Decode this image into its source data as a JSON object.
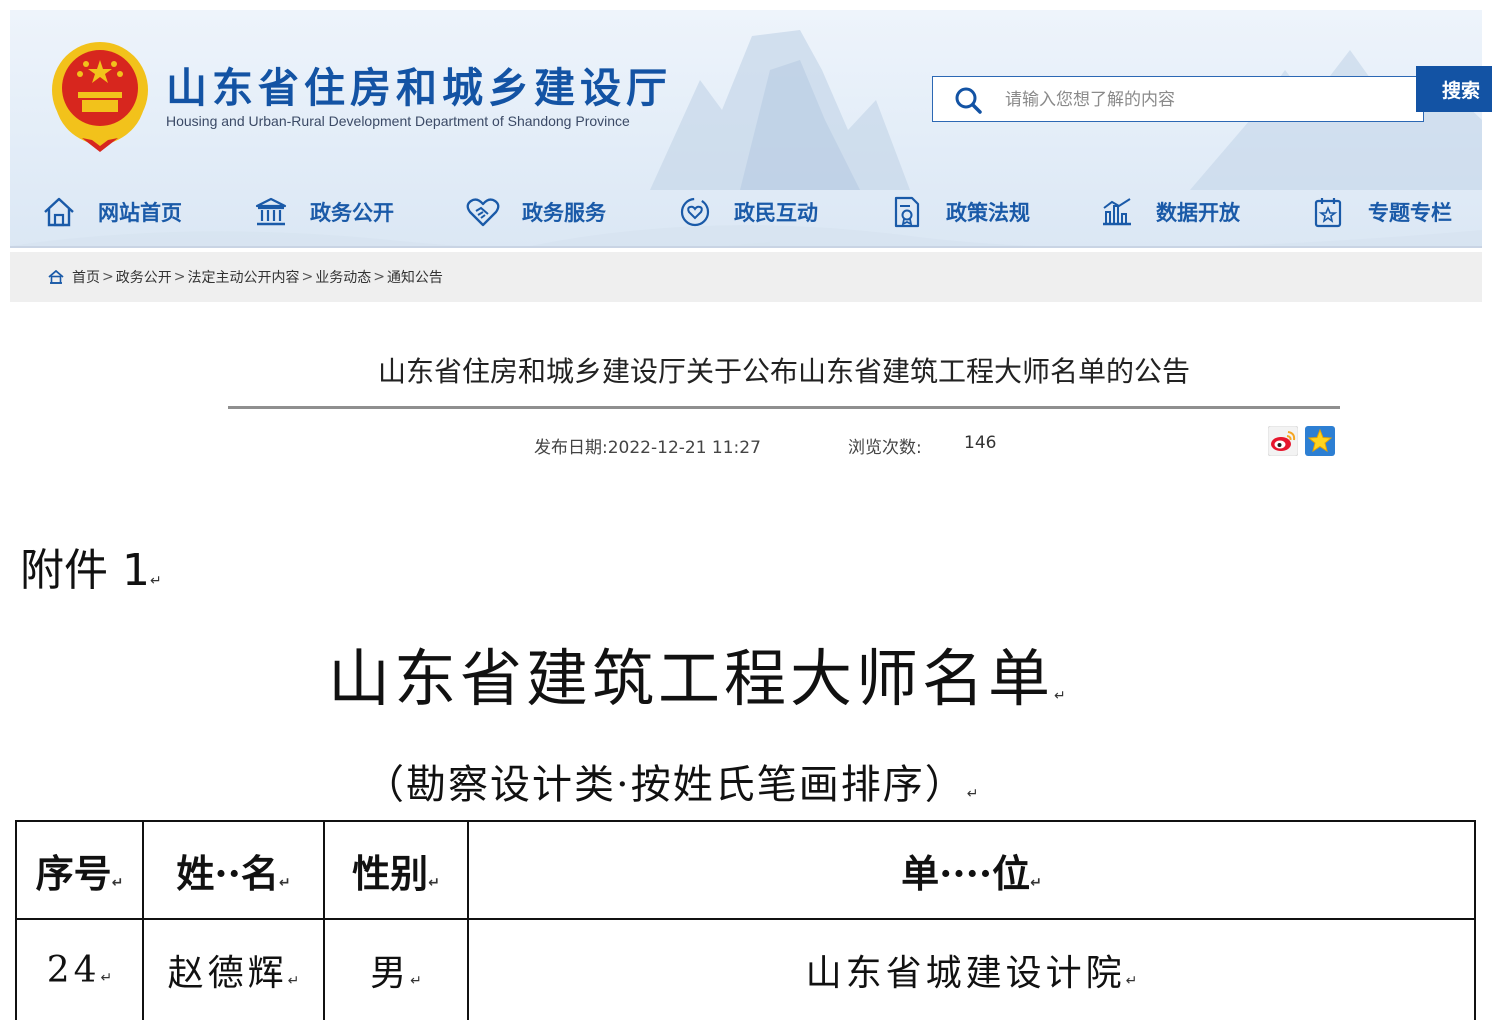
{
  "header": {
    "site_title": "山东省住房和城乡建设厅",
    "site_subtitle": "Housing and Urban-Rural Development Department of Shandong Province",
    "search": {
      "placeholder": "请输入您想了解的内容",
      "button_label": "搜索"
    },
    "nav": [
      {
        "label": "网站首页",
        "icon": "home-icon"
      },
      {
        "label": "政务公开",
        "icon": "government-building-icon"
      },
      {
        "label": "政务服务",
        "icon": "handshake-heart-icon"
      },
      {
        "label": "政民互动",
        "icon": "interaction-heart-icon"
      },
      {
        "label": "政策法规",
        "icon": "document-seal-icon"
      },
      {
        "label": "数据开放",
        "icon": "bar-chart-icon"
      },
      {
        "label": "专题专栏",
        "icon": "special-topic-icon"
      }
    ]
  },
  "breadcrumb": {
    "icon": "home-icon",
    "items": [
      "首页",
      "政务公开",
      "法定主动公开内容",
      "业务动态",
      "通知公告"
    ],
    "separator": ">"
  },
  "article": {
    "title": "山东省住房和城乡建设厅关于公布山东省建筑工程大师名单的公告",
    "date": "发布日期:2022-12-21 11:27",
    "views_label": "浏览次数:",
    "views_value": "146",
    "share_icons": [
      "weibo-icon",
      "favorite-star-icon"
    ]
  },
  "document": {
    "attachment": "附件 1",
    "title": "山东省建筑工程大师名单",
    "subtitle": "（勘察设计类·按姓氏笔画排序）",
    "paragraph_mark": "↵",
    "table": {
      "headers": [
        "序号",
        "姓··名",
        "性别",
        "单····位"
      ],
      "rows": [
        [
          "24",
          "赵德辉",
          "男",
          "山东省城建设计院"
        ]
      ]
    }
  },
  "colors": {
    "brand_blue": "#1353a4",
    "nav_blue": "#1a5aa8",
    "emblem_red": "#d7261e",
    "emblem_gold": "#f2c21b"
  }
}
